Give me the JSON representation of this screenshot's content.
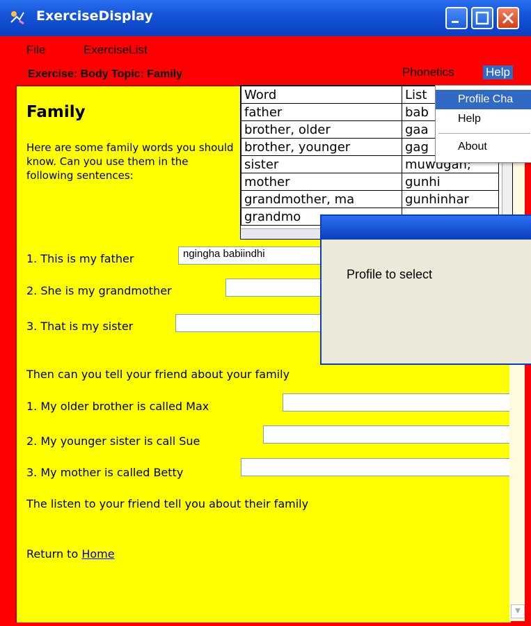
{
  "window": {
    "title": "ExerciseDisplay",
    "colors": {
      "titlebar": "#1555d8",
      "background": "#ff0000",
      "content": "#ffff00",
      "highlight": "#316ac5"
    }
  },
  "menubar": {
    "file": "File",
    "exercise_list": "ExerciseList"
  },
  "subbar": {
    "exercise_label": "Exercise: Body  Topic: Family",
    "phonetics": "Phonetics",
    "help": "Help"
  },
  "help_menu": {
    "items": [
      "Profile Cha",
      "Help",
      "About"
    ]
  },
  "content": {
    "heading": "Family",
    "intro": "Here are some family words you should know. Can you use them in the following sentences:",
    "questions1": [
      {
        "text": "1. This is my father",
        "value": "ngingha babiindhi"
      },
      {
        "text": "2. She is my grandmother",
        "value": ""
      },
      {
        "text": "3. That is my sister",
        "value": ""
      }
    ],
    "section2": "Then can you tell your friend about your family",
    "questions2": [
      {
        "text": "1. My older brother is called Max",
        "value": ""
      },
      {
        "text": "2. My younger sister is call Sue",
        "value": ""
      },
      {
        "text": "3. My mother is called Betty",
        "value": ""
      }
    ],
    "listen": "The listen to your friend tell you about their family",
    "return_prefix": "Return to",
    "return_link": "Home"
  },
  "word_table": {
    "headers": [
      "Word",
      "List"
    ],
    "rows": [
      [
        "father",
        "bab"
      ],
      [
        "brother, older",
        "gaa"
      ],
      [
        "brother, younger",
        "gag"
      ],
      [
        "sister",
        "muwugan;"
      ],
      [
        "mother",
        "gunhi"
      ],
      [
        "grandmother, ma",
        "gunhinhar"
      ],
      [
        "grandmo",
        ""
      ]
    ]
  },
  "dialog": {
    "message": "Profile to select"
  }
}
